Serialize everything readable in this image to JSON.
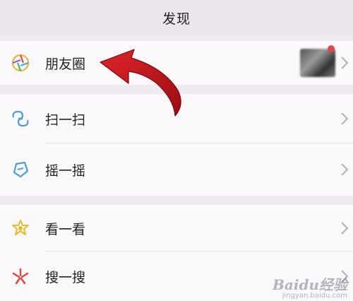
{
  "header": {
    "title": "发现"
  },
  "items": [
    {
      "label": "朋友圈",
      "icon": "moments-icon",
      "has_thumbnail": true
    },
    {
      "label": "扫一扫",
      "icon": "scan-icon"
    },
    {
      "label": "摇一摇",
      "icon": "shake-icon"
    },
    {
      "label": "看一看",
      "icon": "top-stories-icon"
    },
    {
      "label": "搜一搜",
      "icon": "search-icon"
    }
  ],
  "overlay": {
    "annotation_arrow_color": "#c4121c"
  },
  "watermark": {
    "brand": "Baidu经验",
    "url": "jingyan.baidu.com"
  }
}
